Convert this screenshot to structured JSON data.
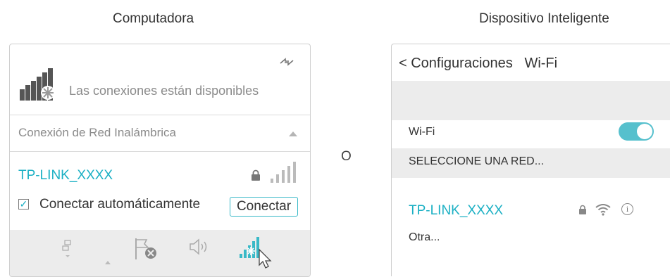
{
  "headings": {
    "computer": "Computadora",
    "or": "O",
    "smart_device": "Dispositivo Inteligente"
  },
  "computer": {
    "status_text": "Las conexiones están disponibles",
    "section_label": "Conexión de Red Inalámbrica",
    "network": {
      "ssid": "TP-LINK_XXXX",
      "secured": true,
      "auto_connect_checked": true,
      "auto_connect_label": "Conectar automáticamente",
      "connect_button": "Conectar"
    },
    "icons": [
      "refresh-arrows-icon",
      "network-available-icon",
      "lock-icon",
      "signal-bars-icon",
      "network-icon",
      "flag-error-icon",
      "speaker-icon",
      "wifi-tray-icon",
      "cursor-icon"
    ]
  },
  "smart_device": {
    "back_label": "< Configuraciones",
    "page_title": "Wi-Fi",
    "wifi_label": "Wi-Fi",
    "wifi_enabled": true,
    "section_label": "SELECCIONE UNA RED...",
    "network": {
      "ssid": "TP-LINK_XXXX",
      "secured": true
    },
    "other_label": "Otra...",
    "icons": [
      "lock-icon",
      "wifi-icon",
      "info-icon"
    ]
  },
  "colors": {
    "accent": "#1bb0c4",
    "toggle_on": "#56c0cd",
    "band_gray": "#ececec"
  }
}
